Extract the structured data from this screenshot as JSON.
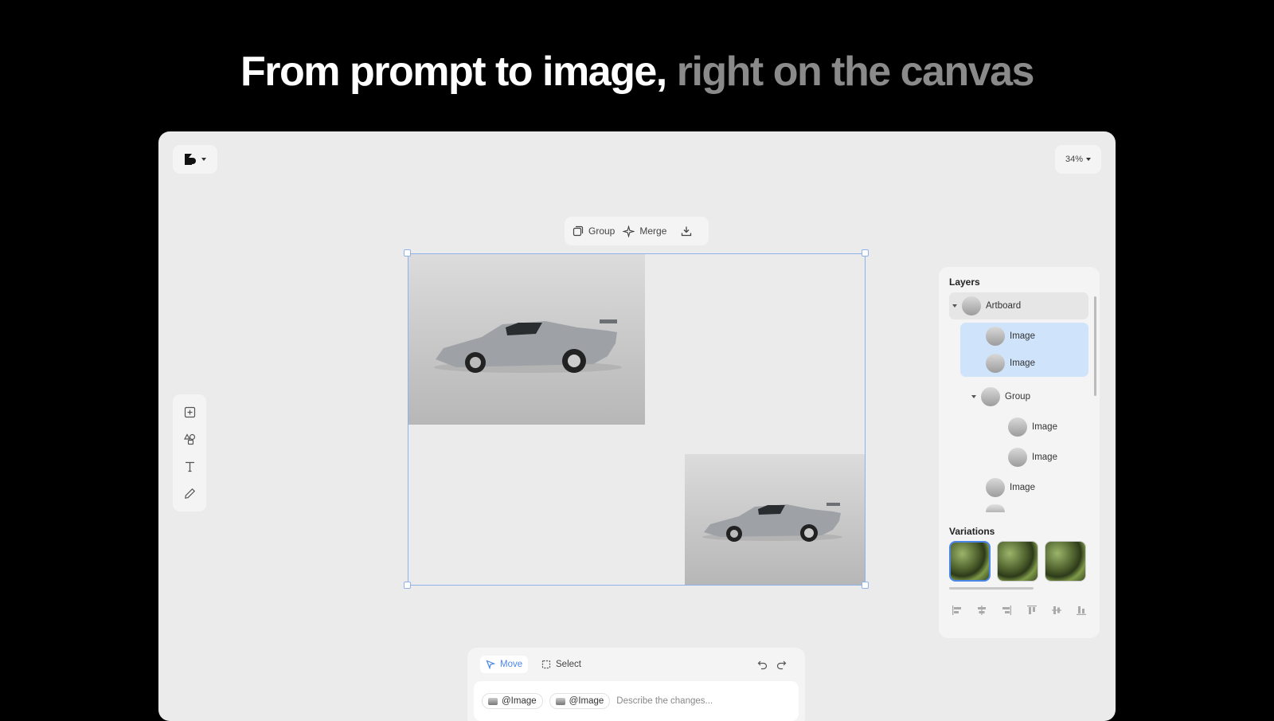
{
  "headline": {
    "main": "From prompt to image,",
    "muted": " right on the canvas"
  },
  "topbar": {
    "zoom": "34%"
  },
  "selection_toolbar": {
    "group_label": "Group",
    "merge_label": "Merge"
  },
  "layers_panel": {
    "title": "Layers",
    "items": [
      {
        "label": "Artboard",
        "depth": 0,
        "expanded": true,
        "selected": false
      },
      {
        "label": "Image",
        "depth": 1,
        "selected": true
      },
      {
        "label": "Image",
        "depth": 1,
        "selected": true
      },
      {
        "label": "Group",
        "depth": 1,
        "expanded": true,
        "selected": false
      },
      {
        "label": "Image",
        "depth": 2,
        "selected": false
      },
      {
        "label": "Image",
        "depth": 2,
        "selected": false
      },
      {
        "label": "Image",
        "depth": 1,
        "selected": false
      }
    ]
  },
  "variations": {
    "title": "Variations",
    "count": 3,
    "selected_index": 0
  },
  "bottom_bar": {
    "modes": [
      {
        "label": "Move",
        "active": true
      },
      {
        "label": "Select",
        "active": false
      }
    ],
    "chips": [
      "@Image",
      "@Image"
    ],
    "placeholder": "Describe the changes..."
  },
  "colors": {
    "accent": "#4a86e8",
    "selection": "#8fb2ea",
    "layer_selected": "#cfe3fb",
    "canvas": "#ebebeb"
  }
}
